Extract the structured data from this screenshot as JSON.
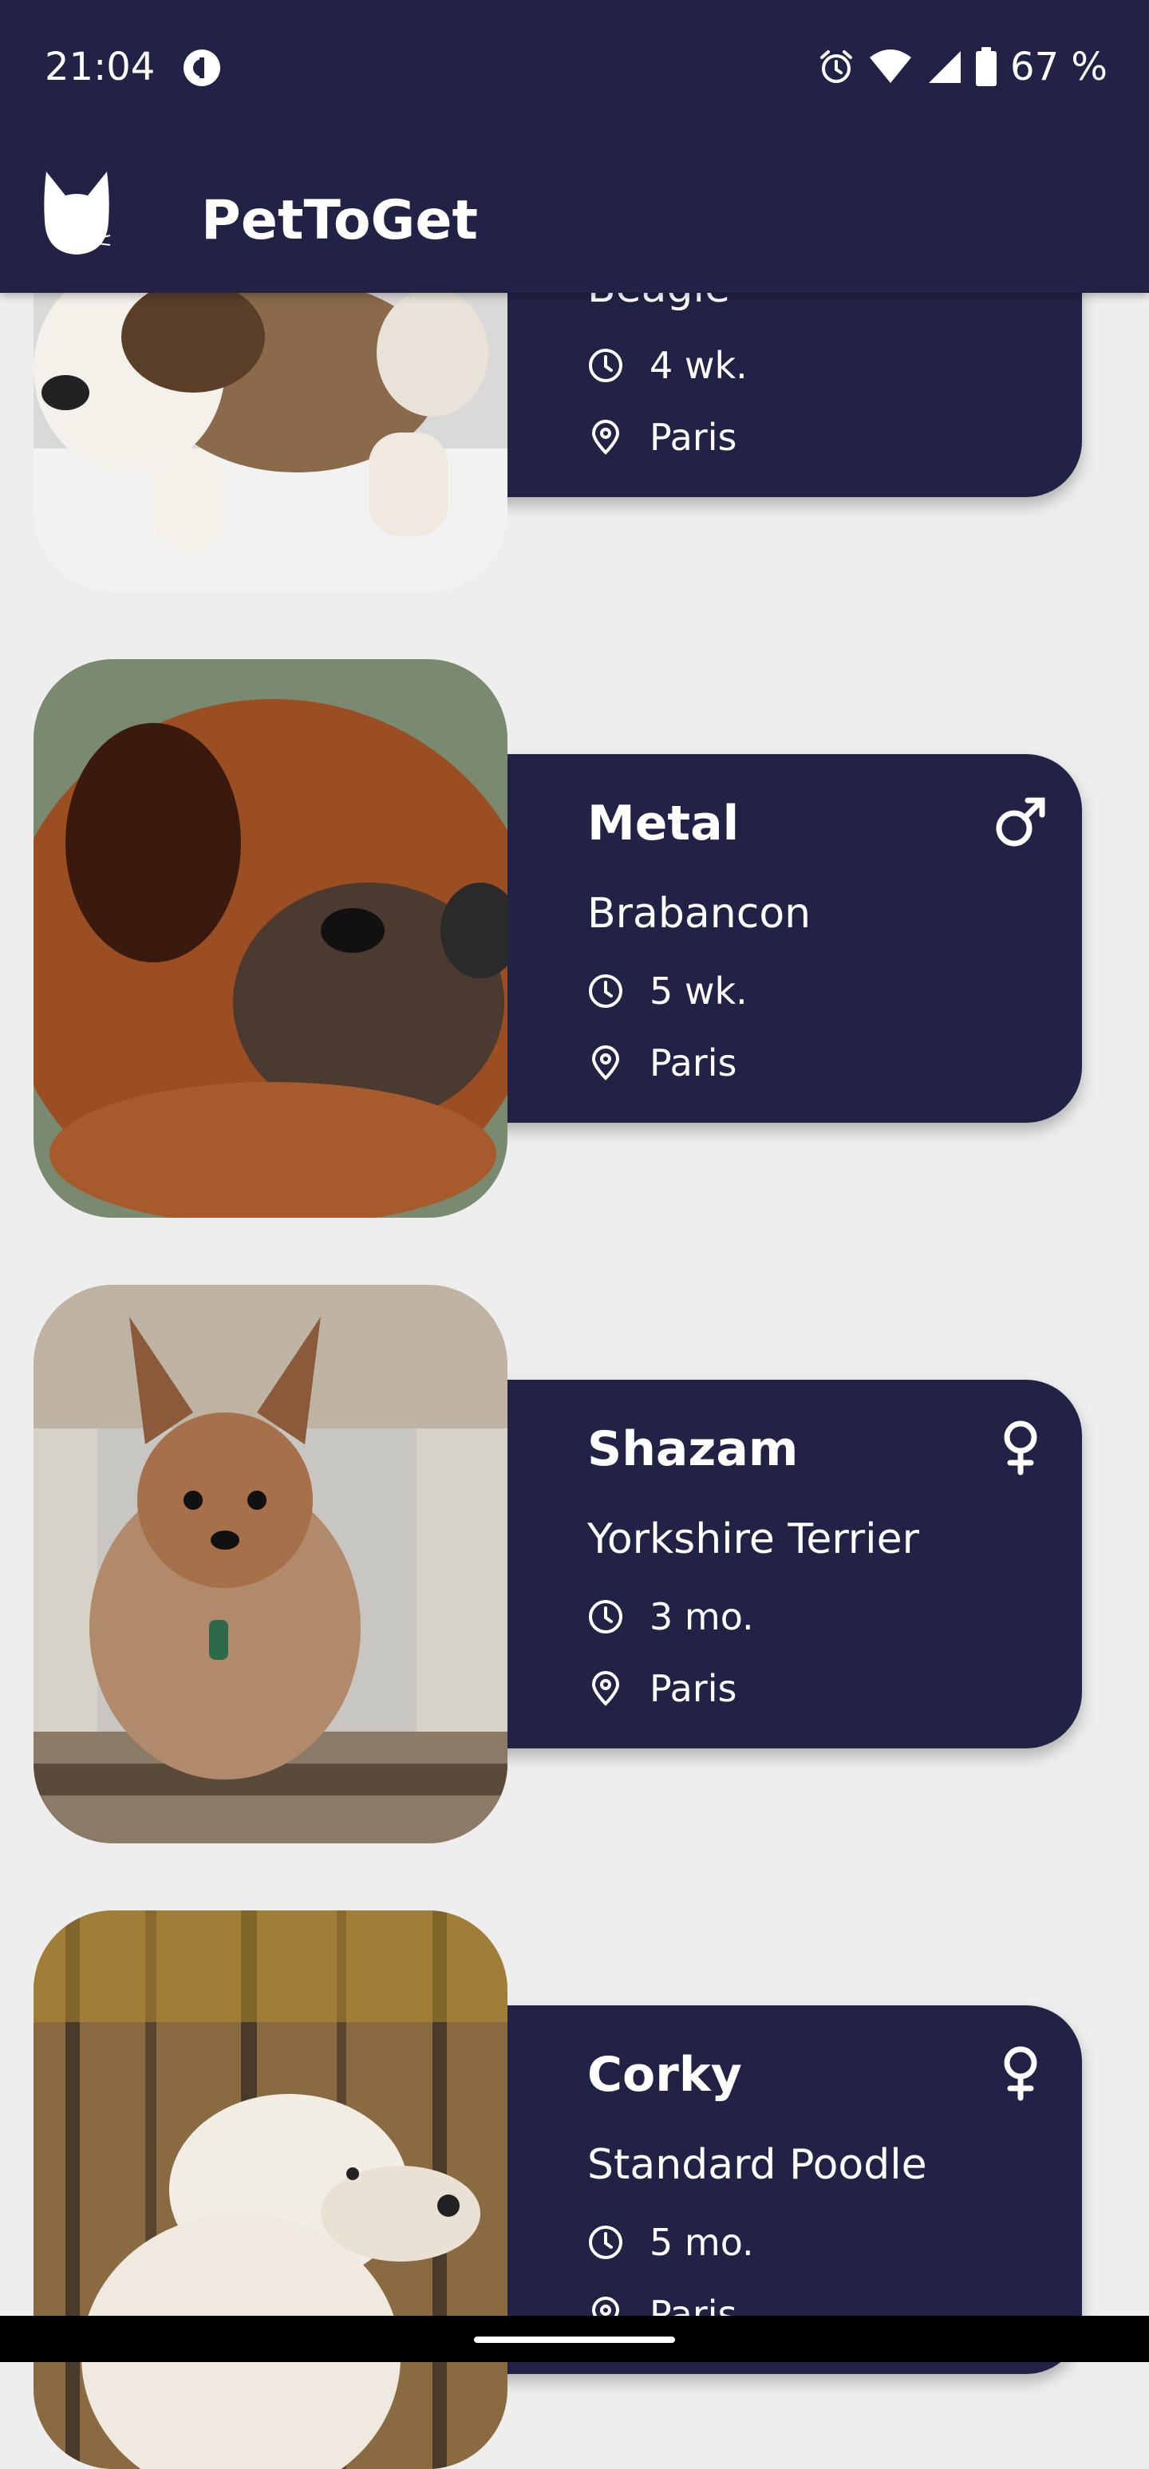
{
  "status_bar": {
    "time": "21:04",
    "battery": "67 %",
    "icons": [
      "app-notification-icon",
      "alarm-icon",
      "wifi-icon",
      "signal-icon",
      "battery-icon"
    ]
  },
  "app_bar": {
    "title": "PetToGet",
    "logo_icon": "cat-head-logo-icon"
  },
  "pets": [
    {
      "name": "",
      "breed": "Beagle",
      "age": "4 wk.",
      "location": "Paris",
      "gender": "unknown",
      "photo": "beagle-puppy"
    },
    {
      "name": "Metal",
      "breed": "Brabancon",
      "age": "5 wk.",
      "location": "Paris",
      "gender": "male",
      "photo": "brabancon-dog"
    },
    {
      "name": "Shazam",
      "breed": "Yorkshire Terrier",
      "age": "3 mo.",
      "location": "Paris",
      "gender": "female",
      "photo": "yorkshire-terrier"
    },
    {
      "name": "Corky",
      "breed": "Standard Poodle",
      "age": "5 mo.",
      "location": "Paris",
      "gender": "female",
      "photo": "standard-poodle"
    }
  ],
  "colors": {
    "primary": "#212245",
    "background": "#EEEEEE",
    "on_primary": "#FFFFFF"
  }
}
